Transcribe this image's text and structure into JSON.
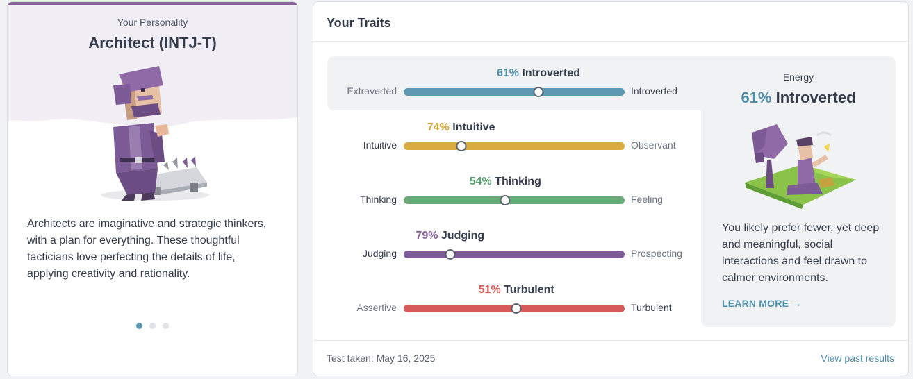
{
  "personality": {
    "label": "Your Personality",
    "type_name": "Architect (INTJ-T)",
    "description": "Architects are imaginative and strategic thinkers, with a plan for everything. These thoughtful tacticians love perfecting the details of life, applying creativity and rationality.",
    "carousel_dots": 3,
    "active_dot": 0,
    "accent_color": "#88619a"
  },
  "traits_panel": {
    "title": "Your Traits",
    "traits": [
      {
        "percent": "61%",
        "name": "Introverted",
        "left_label": "Extraverted",
        "right_label": "Introverted",
        "value": 61,
        "toward": "right",
        "color": "#4f8ea9",
        "bar_color": "#5d97b2"
      },
      {
        "percent": "74%",
        "name": "Intuitive",
        "left_label": "Intuitive",
        "right_label": "Observant",
        "value": 74,
        "toward": "left",
        "color": "#d1a533",
        "bar_color": "#d9ac3f"
      },
      {
        "percent": "54%",
        "name": "Thinking",
        "left_label": "Thinking",
        "right_label": "Feeling",
        "value": 54,
        "toward": "left",
        "color": "#56a16e",
        "bar_color": "#6aa878"
      },
      {
        "percent": "79%",
        "name": "Judging",
        "left_label": "Judging",
        "right_label": "Prospecting",
        "value": 79,
        "toward": "left",
        "color": "#88619a",
        "bar_color": "#7d5b96"
      },
      {
        "percent": "51%",
        "name": "Turbulent",
        "left_label": "Assertive",
        "right_label": "Turbulent",
        "value": 51,
        "toward": "right",
        "color": "#d5564f",
        "bar_color": "#d75a5a"
      }
    ],
    "footer": {
      "test_taken": "Test taken: May 16, 2025",
      "view_past": "View past results"
    }
  },
  "energy": {
    "label": "Energy",
    "percent": "61%",
    "name": "Introverted",
    "description": "You likely prefer fewer, yet deep and meaningful, social interactions and feel drawn to calmer environments.",
    "learn_more": "LEARN MORE →"
  }
}
